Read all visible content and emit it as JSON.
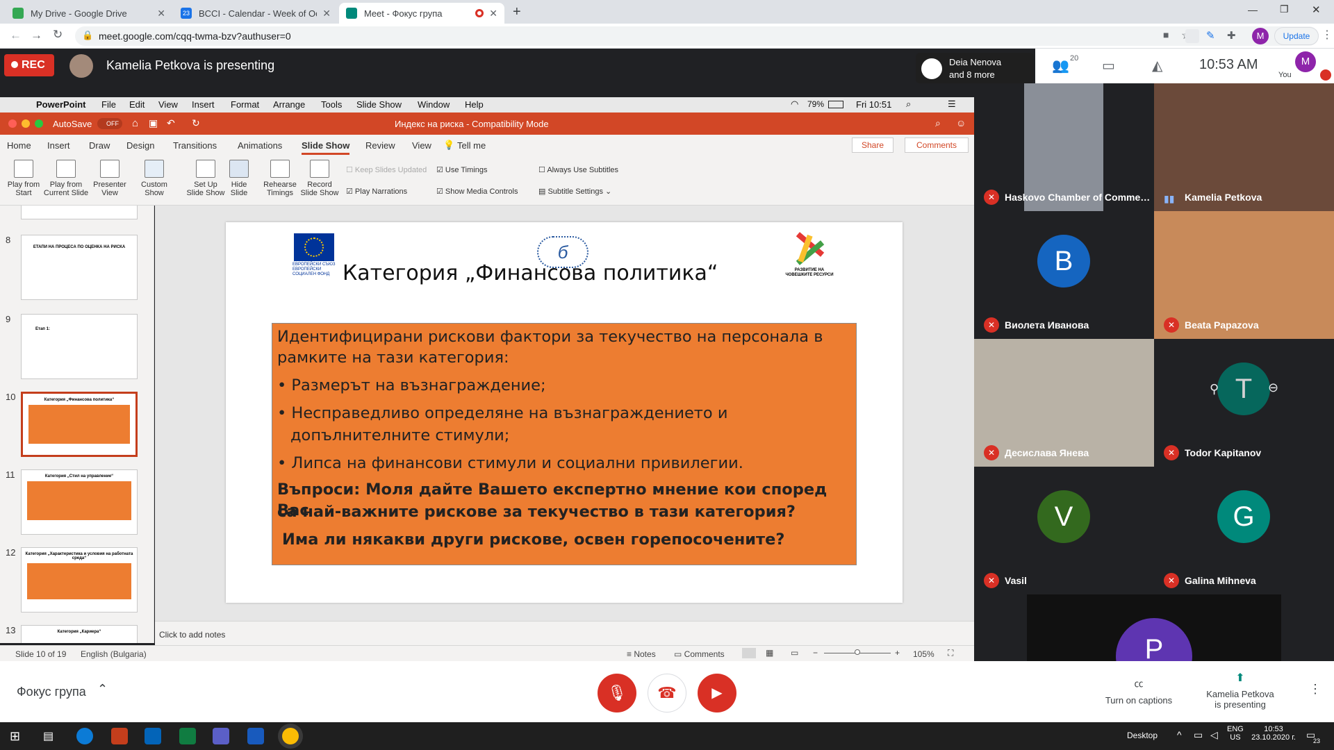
{
  "browser": {
    "tabs": [
      {
        "title": "My Drive - Google Drive",
        "color": "#34a853"
      },
      {
        "title": "BCCI - Calendar - Week of Octob",
        "color": "#1a73e8",
        "badge": "23"
      },
      {
        "title": "Meet - Фокус група",
        "color": "#00897b"
      }
    ],
    "new_tab": "+",
    "url": "meet.google.com/cqq-twma-bzv?authuser=0",
    "profile": "M",
    "update": "Update"
  },
  "meet": {
    "rec": "REC",
    "presenting": "Kamelia Petkova is presenting",
    "joined_name": "Deia Nenova",
    "joined_more": "and 8 more",
    "people_count": "20",
    "time": "10:53 AM",
    "you": "You",
    "you_initial": "M",
    "meeting_title": "Фокус група",
    "captions": "Turn on captions",
    "presenting_short": "Kamelia Petkova",
    "presenting_short2": "is presenting"
  },
  "mac_menu": {
    "app": "PowerPoint",
    "items": [
      "File",
      "Edit",
      "View",
      "Insert",
      "Format",
      "Arrange",
      "Tools",
      "Slide Show",
      "Window",
      "Help"
    ],
    "battery": "79%",
    "clock": "Fri 10:51"
  },
  "ppt": {
    "autosave": "AutoSave",
    "autosave_state": "OFF",
    "doc_title": "Индекс на риска  -  Compatibility Mode",
    "tabs": [
      "Home",
      "Insert",
      "Draw",
      "Design",
      "Transitions",
      "Animations",
      "Slide Show",
      "Review",
      "View"
    ],
    "tell_me": "Tell me",
    "share": "Share",
    "comments": "Comments",
    "ribbon": [
      {
        "l1": "Play from",
        "l2": "Start"
      },
      {
        "l1": "Play from",
        "l2": "Current Slide"
      },
      {
        "l1": "Presenter",
        "l2": "View"
      },
      {
        "l1": "Custom",
        "l2": "Show"
      },
      {
        "l1": "Set Up",
        "l2": "Slide Show"
      },
      {
        "l1": "Hide",
        "l2": "Slide"
      },
      {
        "l1": "Rehearse",
        "l2": "Timings"
      },
      {
        "l1": "Record",
        "l2": "Slide Show"
      }
    ],
    "checks": {
      "keep": "Keep Slides Updated",
      "timings": "Use Timings",
      "narr": "Play Narrations",
      "media": "Show Media Controls",
      "subs": "Always Use Subtitles",
      "subs_settings": "Subtitle Settings"
    },
    "thumb_numbers": [
      "8",
      "9",
      "10",
      "11",
      "12",
      "13"
    ],
    "thumb_titles": [
      "ЕТАПИ НА ПРОЦЕСА ПО ОЦЕНКА НА РИСКА",
      "Етап 1:",
      "Категория „Финансова политика“",
      "Категория „Стил на управление“",
      "Категория „Характеристика и условия на работната среда“",
      "Категория „Кариера“"
    ],
    "slide": {
      "title": "Категория „Финансова политика“",
      "eu_caption": "ЕВРОПЕЙСКИ СЪЮЗ ЕВРОПЕЙСКИ СОЦИАЛЕН ФОНД",
      "hr_caption": "РАЗВИТИЕ НА ЧОВЕШКИТЕ РЕСУРСИ",
      "line1": "Идентифицирани рискови фактори за текучество на персонала в",
      "line2": "рамките на тази категория:",
      "b1": "• Размерът на възнаграждение;",
      "b2a": "• Несправедливо определяне на възнаграждението и",
      "b2b": "допълнителните стимули;",
      "b3": "• Липса на финансови стимули и социални привилегии.",
      "q1": "Въпроси: Моля дайте Вашето експертно мнение кои според Вас",
      "q2": "са най-важните рискове за текучество в тази категория?",
      "q3": "Има ли някакви други рискове, освен горепосочените?"
    },
    "notes_placeholder": "Click to add notes",
    "status_slide": "Slide 10 of 19",
    "status_lang": "English (Bulgaria)",
    "status_notes": "Notes",
    "status_comments": "Comments",
    "zoom": "105%"
  },
  "participants": [
    {
      "name": "Haskovo Chamber of Commerc...",
      "type": "video",
      "bg": "#8a8f98"
    },
    {
      "name": "Kamelia Petkova",
      "type": "video",
      "bg": "#6b4a3a"
    },
    {
      "name": "Виолета Иванова",
      "type": "avatar",
      "initial": "B",
      "color": "#1565c0"
    },
    {
      "name": "Beata Papazova",
      "type": "video",
      "bg": "#c88a5a"
    },
    {
      "name": "Десислава Янева",
      "type": "video",
      "bg": "#b9b2a6"
    },
    {
      "name": "Todor Kapitanov",
      "type": "avatar",
      "initial": "T",
      "color": "#00796b"
    },
    {
      "name": "Vasil",
      "type": "avatar",
      "initial": "V",
      "color": "#33691e"
    },
    {
      "name": "Galina Mihneva",
      "type": "avatar",
      "initial": "G",
      "color": "#00897b"
    },
    {
      "name": "",
      "type": "avatar",
      "initial": "P",
      "color": "#5e35b1"
    }
  ],
  "taskbar": {
    "desktop": "Desktop",
    "lang1": "ENG",
    "lang2": "US",
    "time": "10:53",
    "date": "23.10.2020 г.",
    "notif": "23"
  }
}
